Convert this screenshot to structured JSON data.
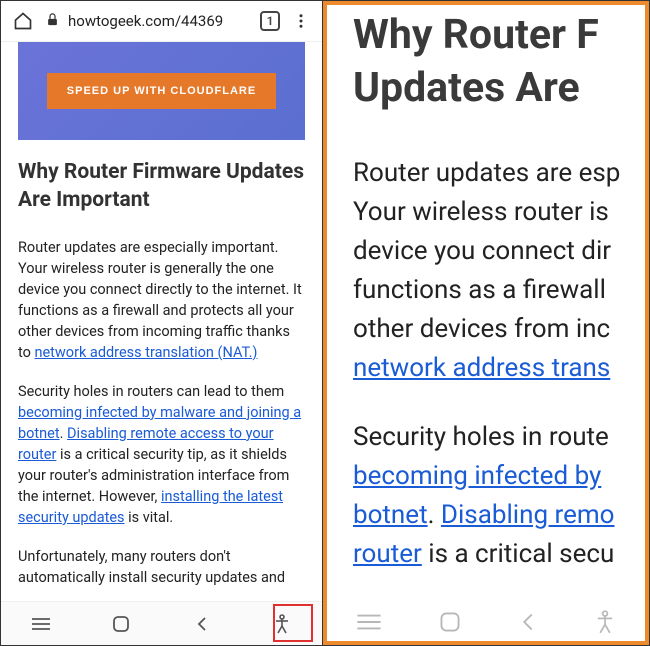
{
  "browser": {
    "url": "howtogeek.com/44369",
    "tab_count": "1"
  },
  "banner": {
    "button_label": "SPEED UP WITH CLOUDFLARE"
  },
  "article": {
    "heading": "Why Router Firmware Updates Are Important",
    "p1_a": "Router updates are especially important. Your wireless router is generally the one device you connect directly to the internet. It functions as a firewall and protects all your other devices from incoming traffic thanks to ",
    "p1_link": "network address translation (NAT.)",
    "p2_a": "Security holes in routers can lead to them ",
    "p2_link1": "becoming infected by malware and joining a botnet",
    "p2_b": ". ",
    "p2_link2": "Disabling remote access to your router",
    "p2_c": " is a critical security tip, as it shields your router's administration interface from the internet. However, ",
    "p2_link3": "installing the latest security updates",
    "p2_d": " is vital.",
    "p3": "Unfortunately, many routers don't automatically install security updates and"
  },
  "zoom": {
    "heading_l1": "Why Router F",
    "heading_l2": "Updates Are",
    "p1_l1": "Router updates are esp",
    "p1_l2": "Your wireless router is",
    "p1_l3": "device you connect dir",
    "p1_l4": "functions as a firewall",
    "p1_l5": "other devices from inc",
    "p1_link": "network address trans",
    "p2_l1": "Security holes in route",
    "p2_link1_l1": "becoming infected by",
    "p2_link1_l2": "botnet",
    "p2_mid": ". ",
    "p2_link2": "Disabling remo",
    "p2_link3": "router",
    "p2_tail": " is a critical secu"
  }
}
